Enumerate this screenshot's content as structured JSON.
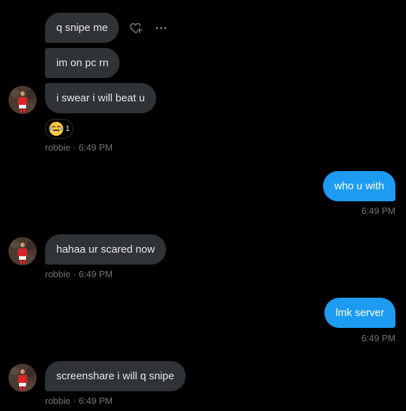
{
  "messages": [
    {
      "text": "q snipe me",
      "direction": "incoming"
    },
    {
      "text": "im on pc rn",
      "direction": "incoming"
    },
    {
      "text": "i swear i will beat u",
      "direction": "incoming",
      "reaction": {
        "emoji": "face-with-tears-of-joy",
        "count": "1"
      },
      "meta": "robbie · 6:49 PM"
    },
    {
      "text": "who u with",
      "direction": "outgoing",
      "meta": "6:49 PM"
    },
    {
      "text": "hahaa ur scared now",
      "direction": "incoming",
      "meta": "robbie · 6:49 PM"
    },
    {
      "text": "lmk server",
      "direction": "outgoing",
      "meta": "6:49 PM"
    },
    {
      "text": "screenshare i will q snipe",
      "direction": "incoming",
      "meta": "robbie · 6:49 PM"
    }
  ],
  "hover_actions": [
    "heart-plus-icon",
    "more-icon"
  ],
  "icons": {
    "avatar": "avatar",
    "reaction": "face-with-tears-of-joy-emoji"
  },
  "colors": {
    "background": "#000000",
    "incoming_bubble": "#2f3336",
    "outgoing_bubble": "#1d9bf0",
    "text_primary": "#e7e9ea",
    "text_secondary": "#71767b"
  }
}
